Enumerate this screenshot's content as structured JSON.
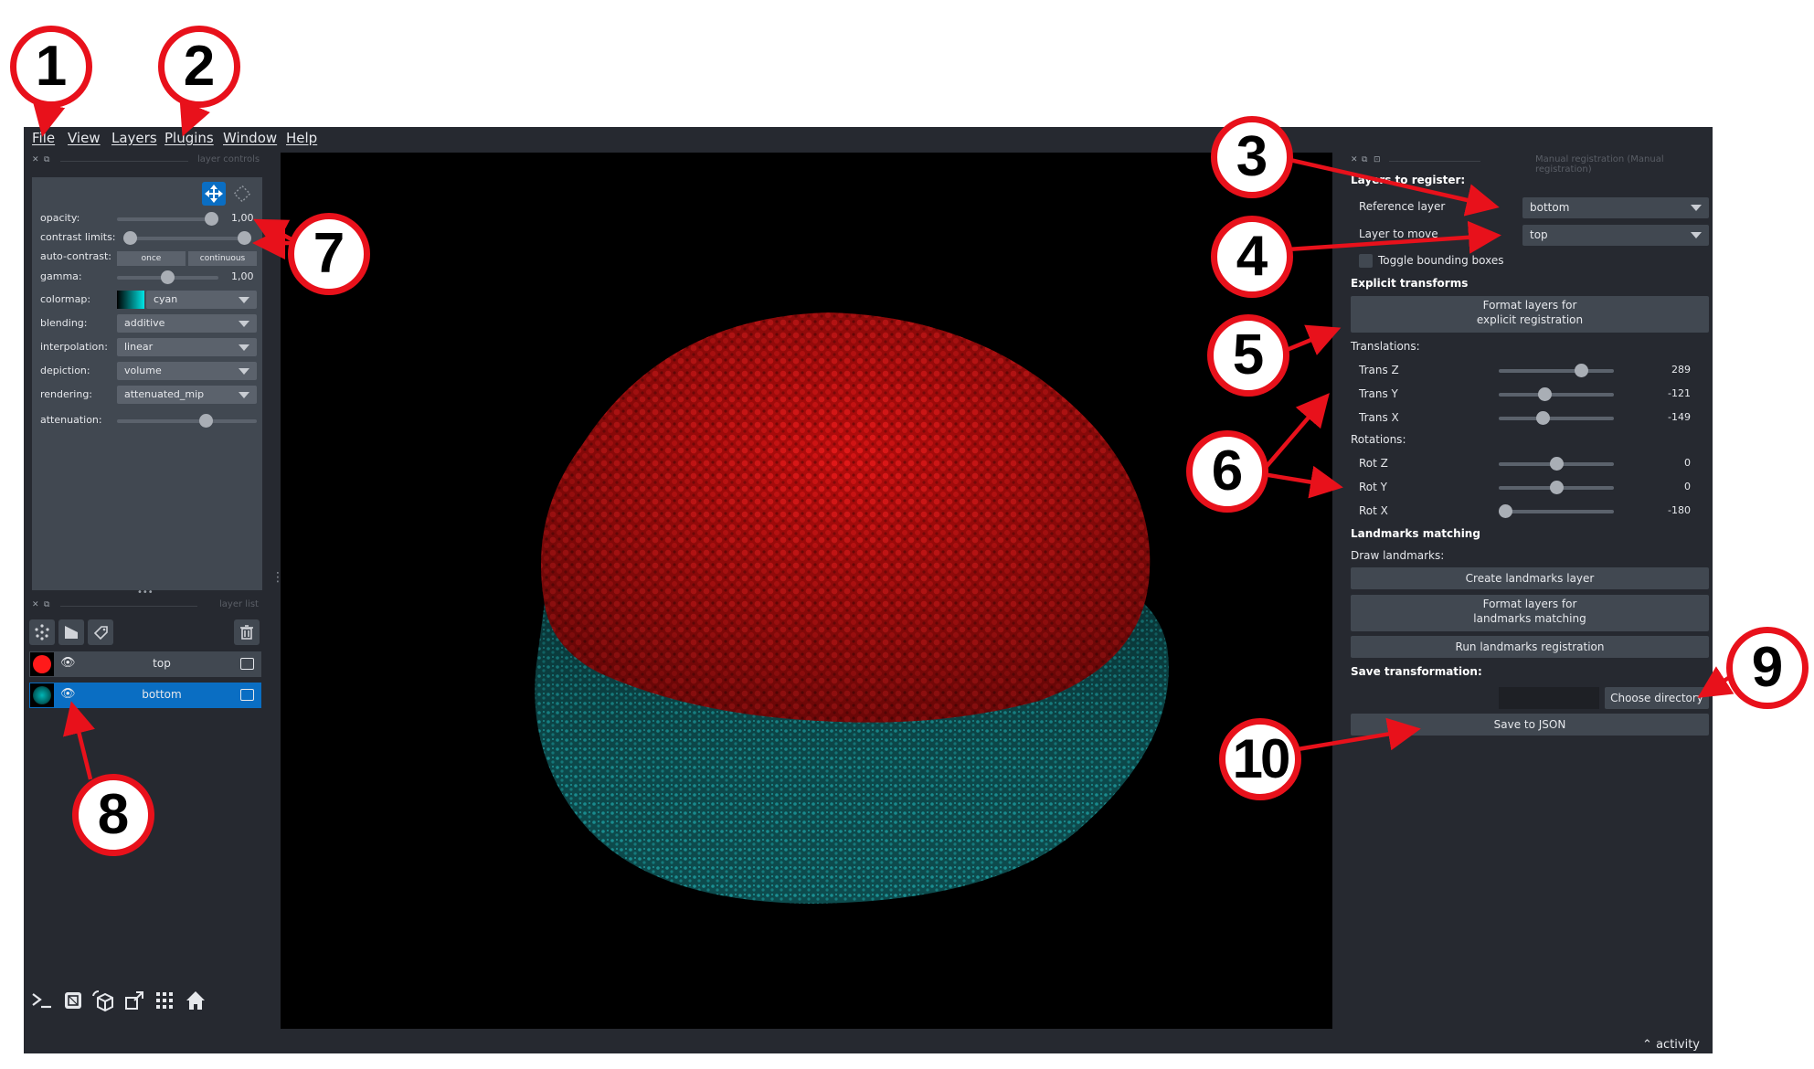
{
  "menu": [
    "File",
    "View",
    "Layers",
    "Plugins",
    "Window",
    "Help"
  ],
  "callouts": [
    "1",
    "2",
    "3",
    "4",
    "5",
    "6",
    "7",
    "8",
    "9",
    "10"
  ],
  "layer_controls": {
    "dock_title": "layer controls",
    "opacity_label": "opacity:",
    "opacity_value": "1,00",
    "opacity": 1.0,
    "contrast_label": "contrast limits:",
    "contrast_low": 0.0,
    "contrast_high": 1.0,
    "auto_contrast_label": "auto-contrast:",
    "once_label": "once",
    "continuous_label": "continuous",
    "gamma_label": "gamma:",
    "gamma_value": "1,00",
    "gamma": 0.5,
    "colormap_label": "colormap:",
    "colormap_value": "cyan",
    "blending_label": "blending:",
    "blending_value": "additive",
    "interpolation_label": "interpolation:",
    "interpolation_value": "linear",
    "depiction_label": "depiction:",
    "depiction_value": "volume",
    "rendering_label": "rendering:",
    "rendering_value": "attenuated_mip",
    "attenuation_label": "attenuation:",
    "attenuation": 0.65,
    "more_handle": "•••"
  },
  "layer_list": {
    "dock_title": "layer list",
    "layers": [
      {
        "name": "top",
        "color": "#ff1a1a",
        "selected": false
      },
      {
        "name": "bottom",
        "color": "#00e5e5",
        "selected": true
      }
    ]
  },
  "viewer_tools": [
    "console-icon",
    "ndisplay-icon",
    "roll-icon",
    "transpose-icon",
    "grid-icon",
    "home-icon"
  ],
  "registration": {
    "dock_title": "Manual registration (Manual registration)",
    "layers_to_register": "Layers to register:",
    "reference_label": "Reference layer",
    "reference_value": "bottom",
    "move_label": "Layer to move",
    "move_value": "top",
    "toggle_label": "Toggle bounding boxes",
    "explicit_title": "Explicit transforms",
    "format_explicit": [
      "Format layers for",
      "explicit registration"
    ],
    "translations_label": "Translations:",
    "translations": [
      {
        "label": "Trans Z",
        "value": "289",
        "fraction": 0.75
      },
      {
        "label": "Trans Y",
        "value": "-121",
        "fraction": 0.39
      },
      {
        "label": "Trans X",
        "value": "-149",
        "fraction": 0.37
      }
    ],
    "rotations_label": "Rotations:",
    "rotations": [
      {
        "label": "Rot Z",
        "value": "0",
        "fraction": 0.5
      },
      {
        "label": "Rot Y",
        "value": "0",
        "fraction": 0.5
      },
      {
        "label": "Rot X",
        "value": "-180",
        "fraction": 0.0
      }
    ],
    "landmarks_title": "Landmarks matching",
    "draw_landmarks": "Draw landmarks:",
    "create_landmarks": "Create landmarks layer",
    "format_landmarks": [
      "Format layers for",
      "landmarks matching"
    ],
    "run_landmarks": "Run landmarks registration",
    "save_title": "Save transformation:",
    "choose_directory": "Choose directory",
    "save_json": "Save to JSON"
  },
  "activity": "activity",
  "colors": {
    "window_bg": "#262930",
    "panel_bg": "#414851",
    "accent": "#0a6ec3",
    "callout": "#e8111b"
  }
}
